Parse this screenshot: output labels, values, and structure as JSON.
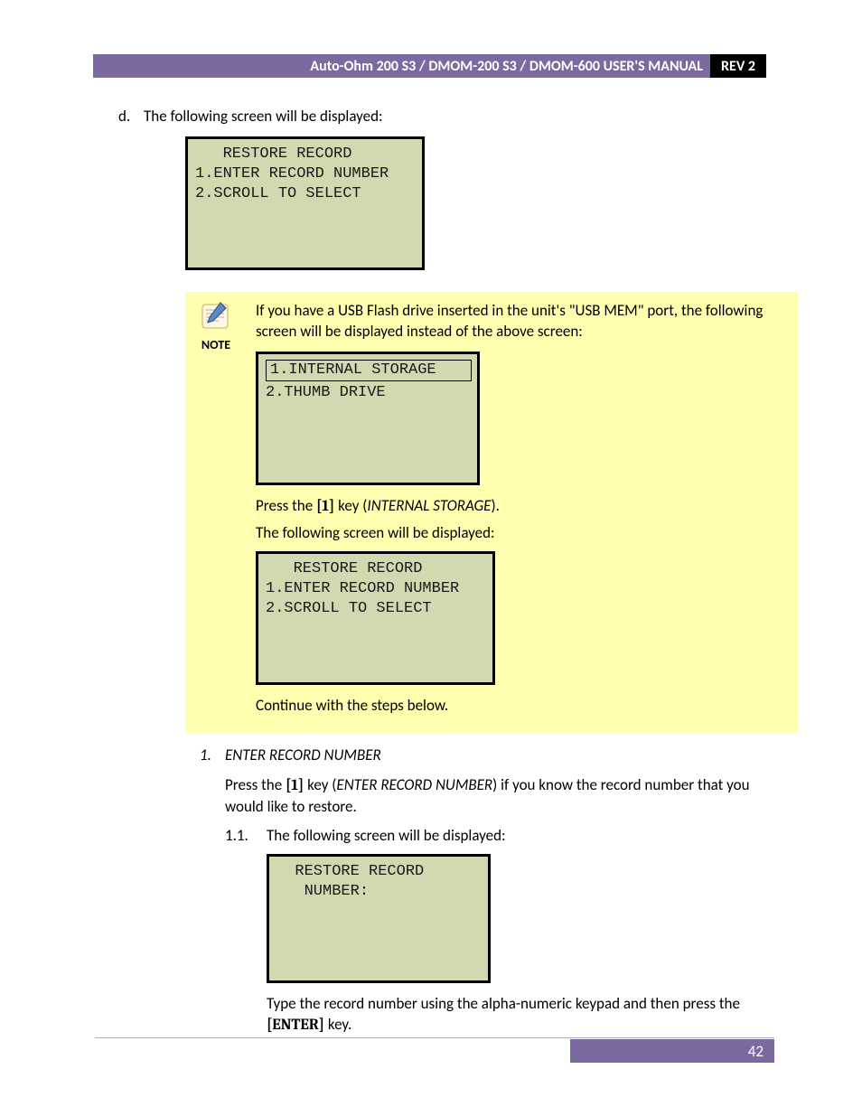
{
  "header": {
    "title": "Auto-Ohm 200 S3 / DMOM-200 S3 / DMOM-600 USER'S MANUAL",
    "rev": "REV 2"
  },
  "step_d": {
    "marker": "d.",
    "text": "The following screen will be displayed:"
  },
  "lcd1": {
    "line1": "   RESTORE RECORD",
    "line2": "1.ENTER RECORD NUMBER",
    "line3": "2.SCROLL TO SELECT"
  },
  "note": {
    "label": "NOTE",
    "intro": "If you have a USB Flash drive inserted in the unit's \"USB MEM\" port, the following screen will be displayed instead of the above screen:",
    "lcd2": {
      "line1_inset": "1.INTERNAL STORAGE",
      "line2": "2.THUMB DRIVE"
    },
    "press_line_pre": "Press the ",
    "press_key": "[1]",
    "press_line_mid": " key (",
    "press_storage": "INTERNAL STORAGE",
    "press_line_post": ").",
    "following": "The following screen will be displayed:",
    "lcd3": {
      "line1": "   RESTORE RECORD",
      "line2": "1.ENTER RECORD NUMBER",
      "line3": "2.SCROLL TO SELECT"
    },
    "continue": "Continue with the steps below."
  },
  "sec1": {
    "num": "1.",
    "title": "ENTER RECORD NUMBER",
    "press_line_pre": "Press the ",
    "press_key": "[1]",
    "press_line_mid": " key (",
    "press_opt": "ENTER RECORD NUMBER",
    "press_line_post": ") if you know the record number that you would like to restore.",
    "sub_num": "1.1.",
    "sub_text": "The following screen will be displayed:",
    "lcd4": {
      "line1": "  RESTORE RECORD",
      "line2": "   NUMBER:"
    },
    "type_line_pre": "Type the record number using the alpha-numeric keypad and then press the ",
    "type_key": "[ENTER]",
    "type_line_post": " key."
  },
  "page_number": "42"
}
